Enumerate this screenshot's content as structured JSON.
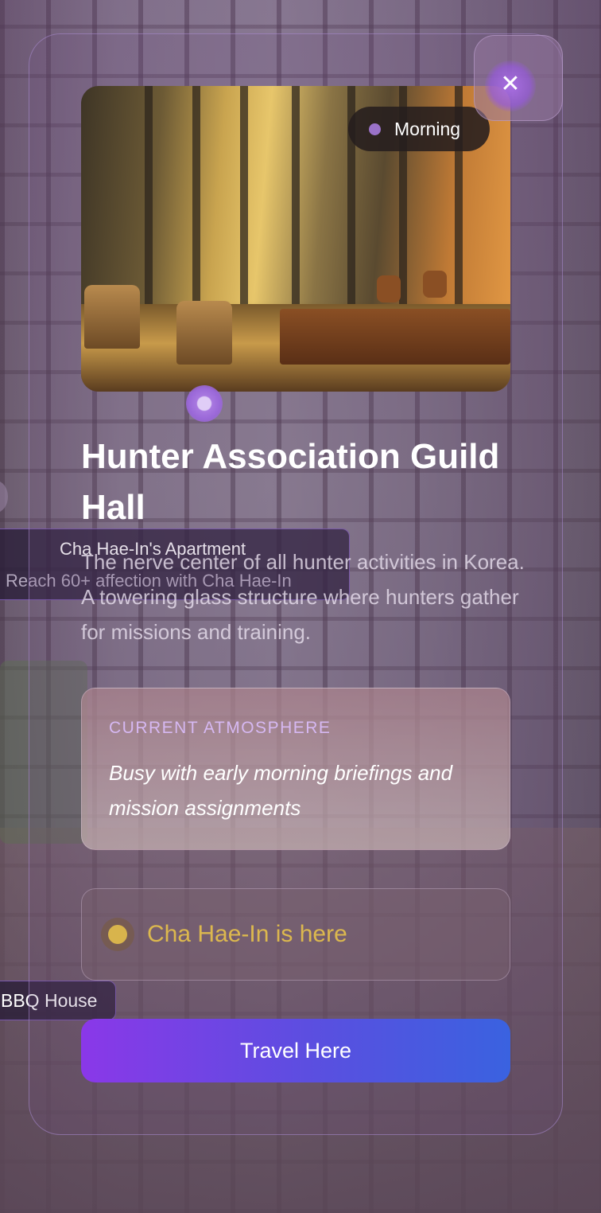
{
  "map_markers": {
    "apartment": {
      "title": "Cha Hae-In's Apartment",
      "requirement": "Reach 60+ affection with Cha Hae-In"
    },
    "bbq": {
      "title": "BBQ House"
    }
  },
  "location_card": {
    "close_icon": "close-icon",
    "close_glyph": "✕",
    "time_of_day": "Morning",
    "title": "Hunter Association Guild Hall",
    "description": "The nerve center of all hunter activities in Korea. A towering glass structure where hunters gather for missions and training.",
    "atmosphere": {
      "label": "CURRENT ATMOSPHERE",
      "text": "Busy with early morning briefings and mission assignments"
    },
    "presence": {
      "text": "Cha Hae-In is here",
      "color": "#d8b44c"
    },
    "travel_button": "Travel Here",
    "accent_gradient": [
      "#8a38e8",
      "#3a62e0"
    ]
  }
}
